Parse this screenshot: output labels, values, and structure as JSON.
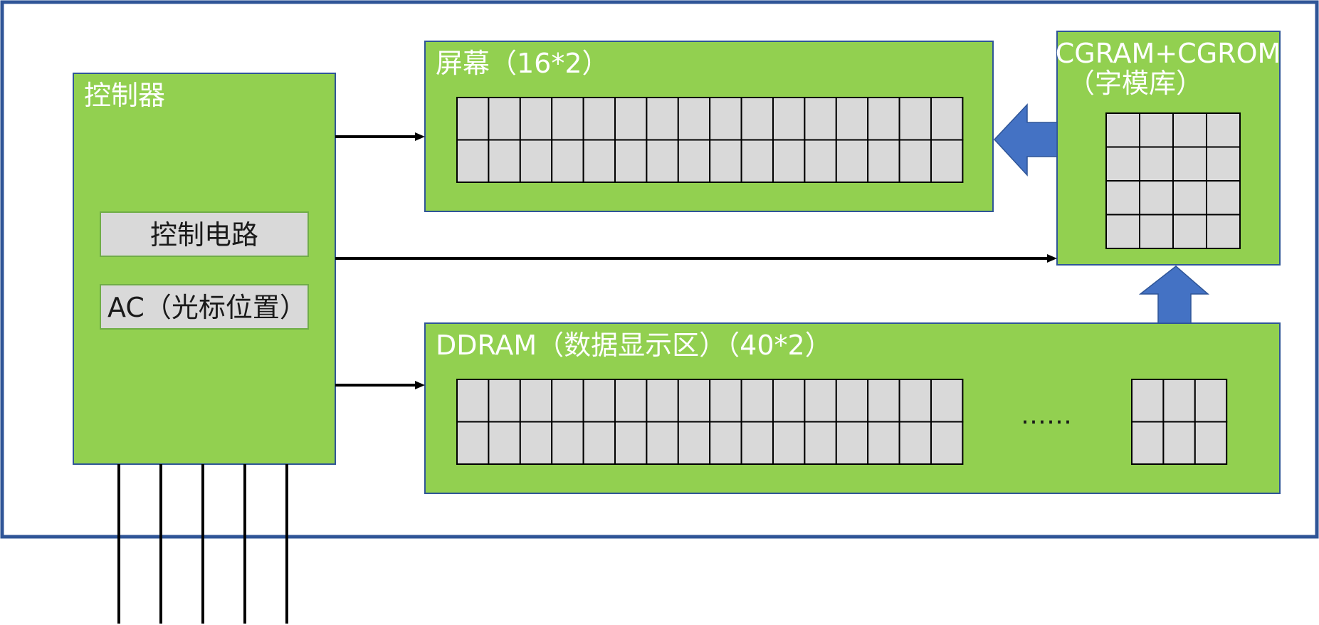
{
  "controller": {
    "title": "控制器",
    "control_circuit": "控制电路",
    "cursor_position": "AC（光标位置）"
  },
  "screen": {
    "title": "屏幕（16*2）"
  },
  "charset_memory": {
    "title_line1": "CGRAM+CGROM",
    "title_line2": "（字模库）"
  },
  "ddram": {
    "title": "DDRAM（数据显示区）（40*2）",
    "ellipsis": "……"
  },
  "colors": {
    "block_fill": "#92d050",
    "block_border": "#2f5597",
    "cell_fill": "#d9d9d9",
    "arrow_fill": "#4472c4"
  },
  "grids": {
    "screen_grid": {
      "rows": 2,
      "cols": 16
    },
    "ddram_grid_main": {
      "rows": 2,
      "cols": 16
    },
    "ddram_grid_tail": {
      "rows": 2,
      "cols": 3
    },
    "charset_grid": {
      "rows": 4,
      "cols": 4
    }
  }
}
